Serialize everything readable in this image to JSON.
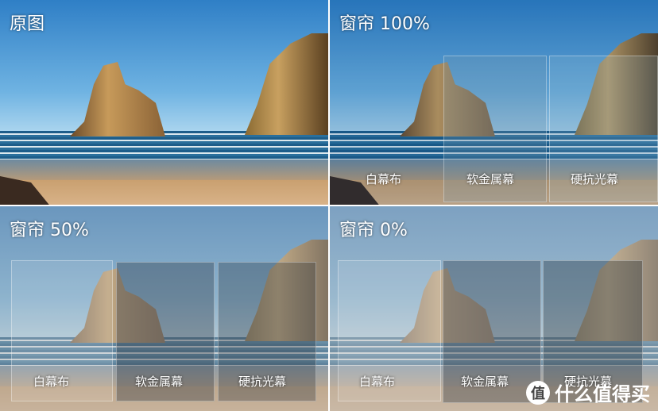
{
  "quadrants": [
    {
      "title": "原图"
    },
    {
      "title": "窗帘 100%",
      "labels": [
        "白幕布",
        "软金属幕",
        "硬抗光幕"
      ]
    },
    {
      "title": "窗帘 50%",
      "labels": [
        "白幕布",
        "软金属幕",
        "硬抗光幕"
      ]
    },
    {
      "title": "窗帘 0%",
      "labels": [
        "白幕布",
        "软金属幕",
        "硬抗光幕"
      ]
    }
  ],
  "watermark": {
    "icon": "值",
    "text": "什么值得买"
  }
}
